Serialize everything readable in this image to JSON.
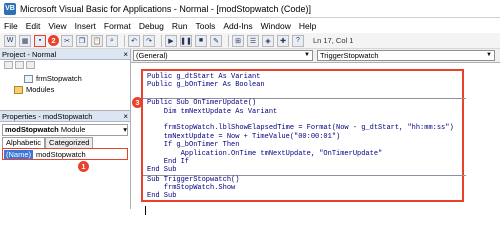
{
  "window": {
    "title": "Microsoft Visual Basic for Applications - Normal - [modStopwatch (Code)]",
    "app_icon": "VB"
  },
  "menu": [
    "File",
    "Edit",
    "View",
    "Insert",
    "Format",
    "Debug",
    "Run",
    "Tools",
    "Add-Ins",
    "Window",
    "Help"
  ],
  "toolbar": {
    "position": "Ln 17, Col 1",
    "badge_save": "2"
  },
  "project_pane": {
    "title": "Project - Normal",
    "close": "×",
    "items": [
      "frmStopwatch",
      "Modules"
    ]
  },
  "properties_pane": {
    "title": "Properties - modStopwatch",
    "close": "×",
    "object_name": "modStopwatch",
    "object_type": "Module",
    "badge": "1",
    "tabs": [
      "Alphabetic",
      "Categorized"
    ],
    "prop_name": "(Name)",
    "prop_value": "modStopwatch"
  },
  "editor": {
    "object_combo": "(General)",
    "proc_combo": "TriggerStopwatch",
    "badge": "3",
    "code_block_1": [
      "Public g_dtStart As Variant",
      "Public g_bOnTimer As Boolean"
    ],
    "code_block_2": [
      "Public Sub OnTimerUpdate()",
      "    Dim tmNextUpdate As Variant",
      "",
      "    frmStopWatch.lblShowElapsedTime = Format(Now - g_dtStart, \"hh:mm:ss\")",
      "    tmNextUpdate = Now + TimeValue(\"00:00:01\")",
      "    If g_bOnTimer Then",
      "        Application.OnTime tmNextUpdate, \"OnTimerUpdate\"",
      "    End If",
      "End Sub"
    ],
    "code_block_3": [
      "Sub TriggerStopwatch()",
      "    frmStopWatch.Show",
      "End Sub"
    ]
  },
  "colors": {
    "highlight_red": "#e8412c",
    "selection_blue": "#3b78d8",
    "code_text": "#00007f"
  }
}
